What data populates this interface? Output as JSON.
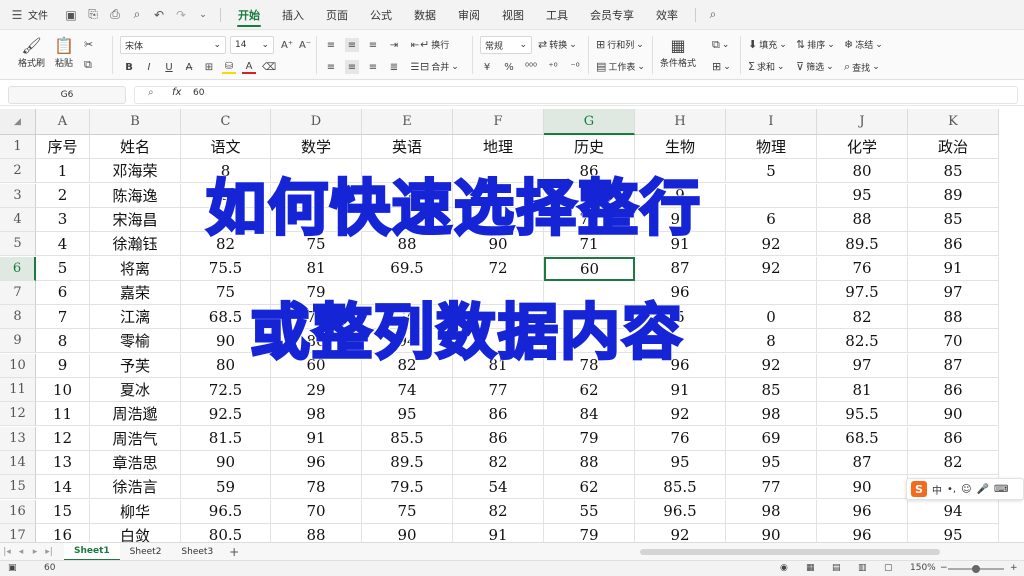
{
  "menubar": {
    "file_label": "文件",
    "tabs": [
      "开始",
      "插入",
      "页面",
      "公式",
      "数据",
      "审阅",
      "视图",
      "工具",
      "会员专享",
      "效率"
    ],
    "active_tab": "开始"
  },
  "ribbon": {
    "format_painter": "格式刷",
    "paste": "粘贴",
    "font_name": "宋体",
    "font_size": "14",
    "wrap_text": "换行",
    "number_format": "常规",
    "convert": "转换",
    "row_col": "行和列",
    "worksheet": "工作表",
    "cond_format": "条件格式",
    "fill": "填充",
    "sort": "排序",
    "freeze": "冻结",
    "sum": "求和",
    "filter": "筛选",
    "find": "查找",
    "merge": "合并"
  },
  "formula_bar": {
    "cell_ref": "G6",
    "fx": "fx",
    "value": "60"
  },
  "grid": {
    "columns": [
      "A",
      "B",
      "C",
      "D",
      "E",
      "F",
      "G",
      "H",
      "I",
      "J",
      "K"
    ],
    "rows": [
      [
        "序号",
        "姓名",
        "语文",
        "数学",
        "英语",
        "地理",
        "历史",
        "生物",
        "物理",
        "化学",
        "政治"
      ],
      [
        "1",
        "邓海荣",
        "8",
        "",
        "",
        "",
        "86",
        "",
        "5",
        "80",
        "85"
      ],
      [
        "2",
        "陈海逸",
        "9",
        "",
        "9",
        "",
        "85",
        "9",
        "",
        "95",
        "89"
      ],
      [
        "3",
        "宋海昌",
        "",
        "",
        "",
        "",
        "72",
        "91",
        "6",
        "88",
        "85"
      ],
      [
        "4",
        "徐瀚钰",
        "82",
        "75",
        "88",
        "90",
        "71",
        "91",
        "92",
        "89.5",
        "86"
      ],
      [
        "5",
        "将离",
        "75.5",
        "81",
        "69.5",
        "72",
        "60",
        "87",
        "92",
        "76",
        "91"
      ],
      [
        "6",
        "嘉荣",
        "75",
        "79",
        "",
        "",
        "",
        "96",
        "",
        "97.5",
        "97"
      ],
      [
        "7",
        "江漓",
        "68.5",
        "72",
        "7",
        "",
        "",
        "5",
        "0",
        "82",
        "88"
      ],
      [
        "8",
        "零榆",
        "90",
        "86",
        "94",
        "",
        "",
        "",
        "8",
        "82.5",
        "70"
      ],
      [
        "9",
        "予芙",
        "80",
        "60",
        "82",
        "81",
        "78",
        "96",
        "92",
        "97",
        "87"
      ],
      [
        "10",
        "夏冰",
        "72.5",
        "29",
        "74",
        "77",
        "62",
        "91",
        "85",
        "81",
        "86"
      ],
      [
        "11",
        "周浩邈",
        "92.5",
        "98",
        "95",
        "86",
        "84",
        "92",
        "98",
        "95.5",
        "90"
      ],
      [
        "12",
        "周浩气",
        "81.5",
        "91",
        "85.5",
        "86",
        "79",
        "76",
        "69",
        "68.5",
        "86"
      ],
      [
        "13",
        "章浩思",
        "90",
        "96",
        "89.5",
        "82",
        "88",
        "95",
        "95",
        "87",
        "82"
      ],
      [
        "14",
        "徐浩言",
        "59",
        "78",
        "79.5",
        "54",
        "62",
        "85.5",
        "77",
        "90",
        ""
      ],
      [
        "15",
        "柳华",
        "96.5",
        "70",
        "75",
        "82",
        "55",
        "96.5",
        "98",
        "96",
        "94"
      ],
      [
        "16",
        "白敛",
        "80.5",
        "88",
        "90",
        "91",
        "79",
        "92",
        "90",
        "96",
        "95"
      ]
    ],
    "selected_cell": "G6"
  },
  "overlay": {
    "line1": "如何快速选择整行",
    "line2": "或整列数据内容"
  },
  "ime": {
    "logo": "S",
    "mode": "中"
  },
  "sheets": [
    "Sheet1",
    "Sheet2",
    "Sheet3"
  ],
  "status": {
    "value": "60",
    "zoom": "150%"
  },
  "colors": {
    "accent": "#1a7a3f",
    "overlay_text": "#1525d6"
  }
}
